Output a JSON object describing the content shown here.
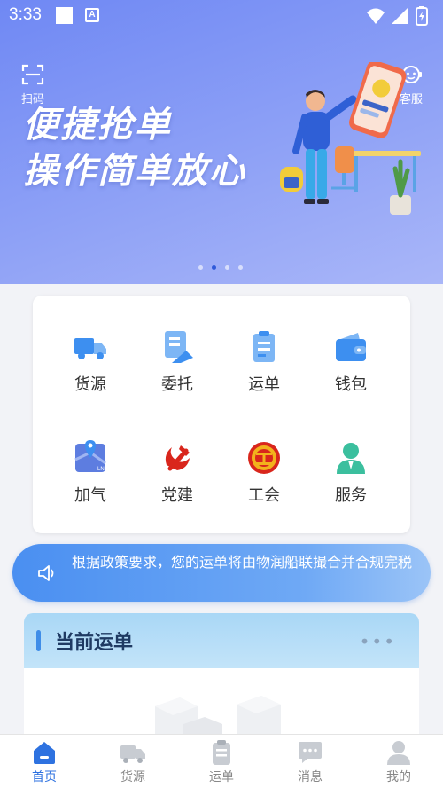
{
  "status_bar": {
    "time": "3:33",
    "notif_icon": "A"
  },
  "banner": {
    "scan_label": "扫码",
    "service_label": "客服",
    "slogan_line1": "便捷抢单",
    "slogan_line2": "操作简单放心",
    "carousel_count": 4,
    "carousel_active": 1
  },
  "grid": {
    "items": [
      {
        "label": "货源",
        "icon": "truck-icon"
      },
      {
        "label": "委托",
        "icon": "delegate-document-icon"
      },
      {
        "label": "运单",
        "icon": "waybill-clipboard-icon"
      },
      {
        "label": "钱包",
        "icon": "wallet-icon"
      },
      {
        "label": "加气",
        "icon": "map-gas-icon"
      },
      {
        "label": "党建",
        "icon": "party-emblem-icon"
      },
      {
        "label": "工会",
        "icon": "union-emblem-icon"
      },
      {
        "label": "服务",
        "icon": "service-person-icon"
      }
    ]
  },
  "notice": {
    "text": "根据政策要求，您的运单将由物润船联撮合并合规完税"
  },
  "current_waybill": {
    "title": "当前运单",
    "more": "•••"
  },
  "tabbar": {
    "tabs": [
      {
        "label": "首页",
        "icon": "home-icon",
        "active": true
      },
      {
        "label": "货源",
        "icon": "truck-icon",
        "active": false
      },
      {
        "label": "运单",
        "icon": "waybill-icon",
        "active": false
      },
      {
        "label": "消息",
        "icon": "message-icon",
        "active": false
      },
      {
        "label": "我的",
        "icon": "user-icon",
        "active": false
      }
    ]
  },
  "colors": {
    "primary": "#2e72e0",
    "banner": "#7b8ff5",
    "notice": "#4a8ff1",
    "party_red": "#d9261c"
  }
}
